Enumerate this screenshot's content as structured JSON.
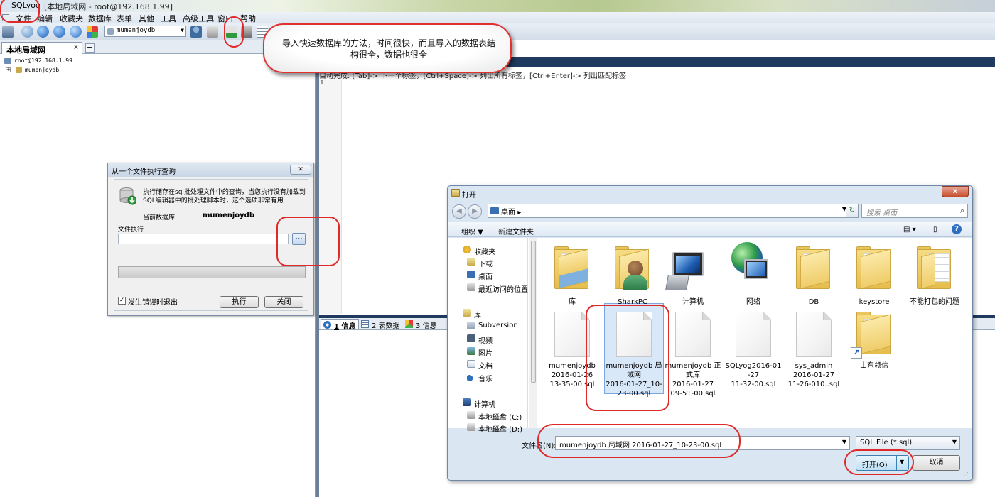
{
  "window": {
    "app_name": "SQLyog",
    "title_rest": "[本地局域网 - root@192.168.1.99]"
  },
  "menu": [
    "文件",
    "编辑",
    "收藏夹",
    "数据库",
    "表单",
    "其他",
    "工具",
    "高级工具",
    "窗口",
    "帮助"
  ],
  "toolbar": {
    "db_selected": "mumenjoydb"
  },
  "left_panel": {
    "tab_label": "本地局域网",
    "tab_close": "×",
    "tab_add": "+",
    "tree_root": "root@192.168.1.99",
    "tree_child": "mumenjoydb"
  },
  "editor": {
    "hint": "自动完成: [Tab]-> 下一个标签，[Ctrl+Space]-> 列出所有标签，[Ctrl+Enter]-> 列出匹配标签",
    "line_number": "1"
  },
  "result_tabs": [
    {
      "num": "1",
      "label": "信息"
    },
    {
      "num": "2",
      "label": "表数据"
    },
    {
      "num": "3",
      "label": "信息"
    }
  ],
  "callout": {
    "text": "导入快速数据库的方法，时间很快，而且导入的数据表结构很全，数据也很全"
  },
  "exec_dialog": {
    "title": "从一个文件执行查询",
    "close_glyph": "✕",
    "description": "执行储存在sql批处理文件中的查询，当您执行没有加载到SQL编辑器中的批处理脚本时，这个选项非常有用",
    "current_db_label": "当前数据库:",
    "current_db_value": "mumenjoydb",
    "file_label": "文件执行",
    "file_value": "",
    "browse_label": "...",
    "progress": 0,
    "exit_on_error_label": "发生错误时退出",
    "exit_on_error_checked": true,
    "check_glyph": "✓",
    "execute_label": "执行",
    "close_label": "关闭"
  },
  "open_dialog": {
    "title": "打开",
    "close_glyph": "x",
    "back_glyph": "◀",
    "forward_glyph": "▶",
    "address": "桌面",
    "address_sep": "▸",
    "refresh_glyph": "↻",
    "search_placeholder": "搜索 桌面",
    "search_glyph": "⌕",
    "organize": "组织 ▼",
    "new_folder": "新建文件夹",
    "view_glyph": "▤ ▾",
    "pane_glyph": "▯",
    "help_glyph": "?",
    "nav": {
      "favorites_label": "收藏夹",
      "favorites": [
        "下载",
        "桌面",
        "最近访问的位置"
      ],
      "libraries_label": "库",
      "libraries": [
        "Subversion",
        "视频",
        "图片",
        "文档",
        "音乐"
      ],
      "computer_label": "计算机",
      "drives": [
        "本地磁盘 (C:)",
        "本地磁盘 (D:)"
      ]
    },
    "files": [
      {
        "name": "库",
        "kind": "library"
      },
      {
        "name": "SharkPC",
        "kind": "user"
      },
      {
        "name": "计算机",
        "kind": "computer"
      },
      {
        "name": "网络",
        "kind": "network"
      },
      {
        "name": "DB",
        "kind": "folder"
      },
      {
        "name": "keystore",
        "kind": "folder"
      },
      {
        "name": "不能打包的问题",
        "kind": "folder-doc"
      },
      {
        "name": "mumenjoydb 2016-01-26 13-35-00.sql",
        "lines": [
          "mumenjoydb",
          "2016-01-26",
          "13-35-00.sql"
        ],
        "kind": "doc"
      },
      {
        "name": "mumenjoydb 局域网 2016-01-27_10-23-00.sql",
        "lines": [
          "mumenjoydb 局",
          "域网",
          "2016-01-27_10-",
          "23-00.sql"
        ],
        "kind": "doc",
        "selected": true
      },
      {
        "name": "mumenjoydb 正式库 2016-01-27 09-51-00.sql",
        "lines": [
          "mumenjoydb 正",
          "式库",
          "2016-01-27",
          "09-51-00.sql"
        ],
        "kind": "doc"
      },
      {
        "name": "SQLyog2016-01-27 11-32-00.sql",
        "lines": [
          "SQLyog2016-01",
          "-27",
          "11-32-00.sql"
        ],
        "kind": "doc"
      },
      {
        "name": "sys_admin 2016-01-27 11-26-010..sql",
        "lines": [
          "sys_admin",
          "2016-01-27",
          "11-26-010..sql"
        ],
        "kind": "doc"
      },
      {
        "name": "山东领信",
        "kind": "folder-shortcut"
      }
    ],
    "filename_label": "文件名(N):",
    "filename_value": "mumenjoydb 局域网 2016-01-27_10-23-00.sql",
    "filetype": "SQL File (*.sql)",
    "dropdown_glyph": "▼",
    "open_label": "打开(O)",
    "cancel_label": "取消"
  },
  "colors": {
    "annotation_red": "#e02a2a",
    "dark_band": "#1f3a5e",
    "selection_blue": "#d9e8f8"
  }
}
